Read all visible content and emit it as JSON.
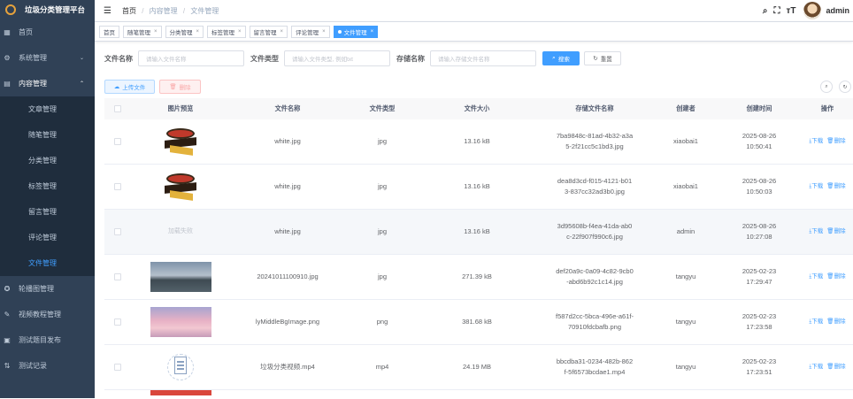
{
  "sidebar": {
    "title": "垃圾分类管理平台",
    "items": [
      {
        "label": "首页",
        "icon": "dashboard-icon"
      },
      {
        "label": "系统管理",
        "icon": "gear-icon",
        "arrow": "⌄"
      },
      {
        "label": "内容管理",
        "icon": "document-icon",
        "arrow": "⌃"
      }
    ],
    "subitems": [
      "文章管理",
      "随笔管理",
      "分类管理",
      "标签管理",
      "留言管理",
      "评论管理",
      "文件管理"
    ],
    "bottom_items": [
      {
        "label": "轮播图管理",
        "icon": "carousel-icon"
      },
      {
        "label": "视频教程管理",
        "icon": "video-icon"
      },
      {
        "label": "测试题目发布",
        "icon": "exam-icon"
      },
      {
        "label": "测试记录",
        "icon": "record-icon"
      }
    ]
  },
  "navbar": {
    "breadcrumb": [
      "首页",
      "内容管理",
      "文件管理"
    ],
    "username": "admin"
  },
  "tags": [
    "首页",
    "随笔管理",
    "分类管理",
    "标签管理",
    "留言管理",
    "评论管理"
  ],
  "active_tag": "文件管理",
  "search": {
    "file_name_label": "文件名称",
    "file_name_placeholder": "请输入文件名称",
    "file_type_label": "文件类型",
    "file_type_placeholder": "请输入文件类型, 例如txt",
    "storage_name_label": "存储名称",
    "storage_name_placeholder": "请输入存储文件名称",
    "search_button": "搜索",
    "reset_button": "重置"
  },
  "toolbar": {
    "upload_button": "上传文件",
    "delete_button": "删除"
  },
  "table": {
    "headers": [
      "图片预览",
      "文件名称",
      "文件类型",
      "文件大小",
      "存储文件名称",
      "创建者",
      "创建时间",
      "操作"
    ],
    "download_label": "下载",
    "delete_label": "删除",
    "load_fail_text": "加载失败",
    "rows": [
      {
        "preview": "logo",
        "name": "white.jpg",
        "type": "jpg",
        "size": "13.16 kB",
        "storage1": "7ba9848c-81ad-4b32-a3a",
        "storage2": "5-2f21cc5c1bd3.jpg",
        "creator": "xiaobai1",
        "date": "2025-08-26",
        "time": "10:50:41"
      },
      {
        "preview": "logo",
        "name": "white.jpg",
        "type": "jpg",
        "size": "13.16 kB",
        "storage1": "dea8d3cd-f015-4121-b01",
        "storage2": "3-837cc32ad3b0.jpg",
        "creator": "xiaobai1",
        "date": "2025-08-26",
        "time": "10:50:03"
      },
      {
        "preview": "fail",
        "name": "white.jpg",
        "type": "jpg",
        "size": "13.16 kB",
        "storage1": "3d95608b-f4ea-41da-ab0",
        "storage2": "c-22f907f990c6.jpg",
        "creator": "admin",
        "date": "2025-08-26",
        "time": "10:27:08"
      },
      {
        "preview": "photo1",
        "name": "20241011100910.jpg",
        "type": "jpg",
        "size": "271.39 kB",
        "storage1": "def20a9c-0a09-4c82-9cb0",
        "storage2": "-abd6b92c1c14.jpg",
        "creator": "tangyu",
        "date": "2025-02-23",
        "time": "17:29:47"
      },
      {
        "preview": "photo2",
        "name": "lyMiddleBgImage.png",
        "type": "png",
        "size": "381.68 kB",
        "storage1": "f587d2cc-5bca-496e-a61f-",
        "storage2": "70910fdcbafb.png",
        "creator": "tangyu",
        "date": "2025-02-23",
        "time": "17:23:58"
      },
      {
        "preview": "file",
        "name": "垃圾分类视频.mp4",
        "type": "mp4",
        "size": "24.19 MB",
        "storage1": "bbcdba31-0234-482b-862",
        "storage2": "f-5f6573bcdae1.mp4",
        "creator": "tangyu",
        "date": "2025-02-23",
        "time": "17:23:51"
      }
    ]
  }
}
